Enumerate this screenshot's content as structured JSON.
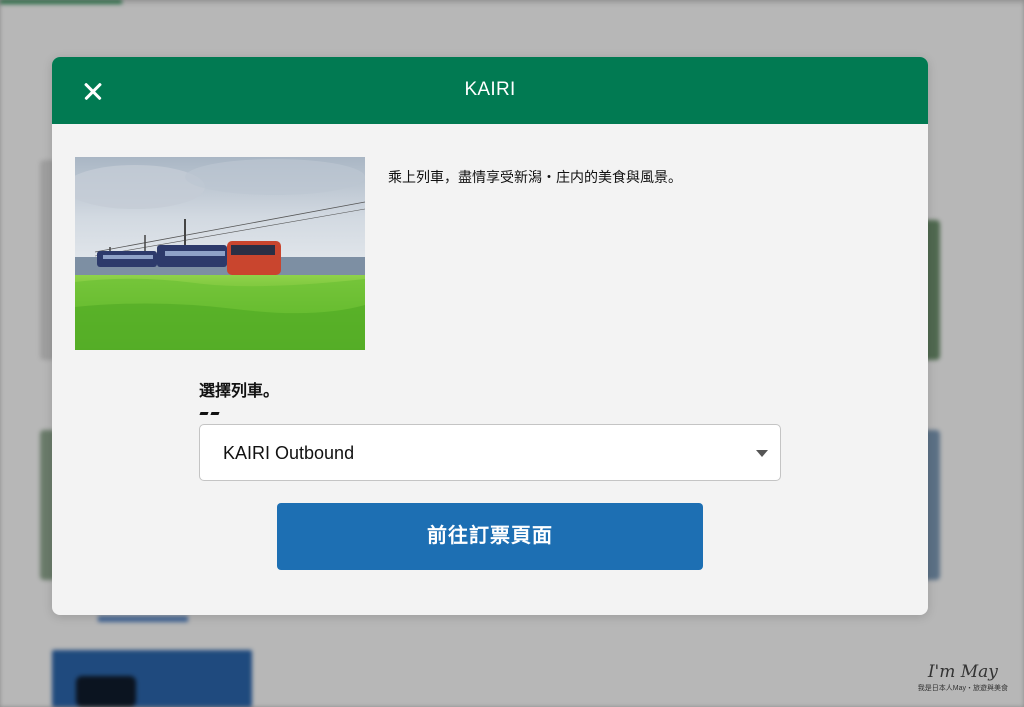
{
  "modal": {
    "title": "KAIRI",
    "description": "乘上列車，盡情享受新潟・庄内的美食與風景。",
    "select_label": "選擇列車。",
    "selected_train": "KAIRI Outbound",
    "booking_button_label": "前往訂票頁面"
  },
  "watermark": {
    "logo": "I'm May",
    "subtitle": "我是日本人May・旅遊與美食"
  },
  "icons": {
    "close": "close-icon",
    "dropdown": "chevron-down-icon"
  },
  "colors": {
    "header_green": "#017a52",
    "button_blue": "#1d6fb3"
  }
}
